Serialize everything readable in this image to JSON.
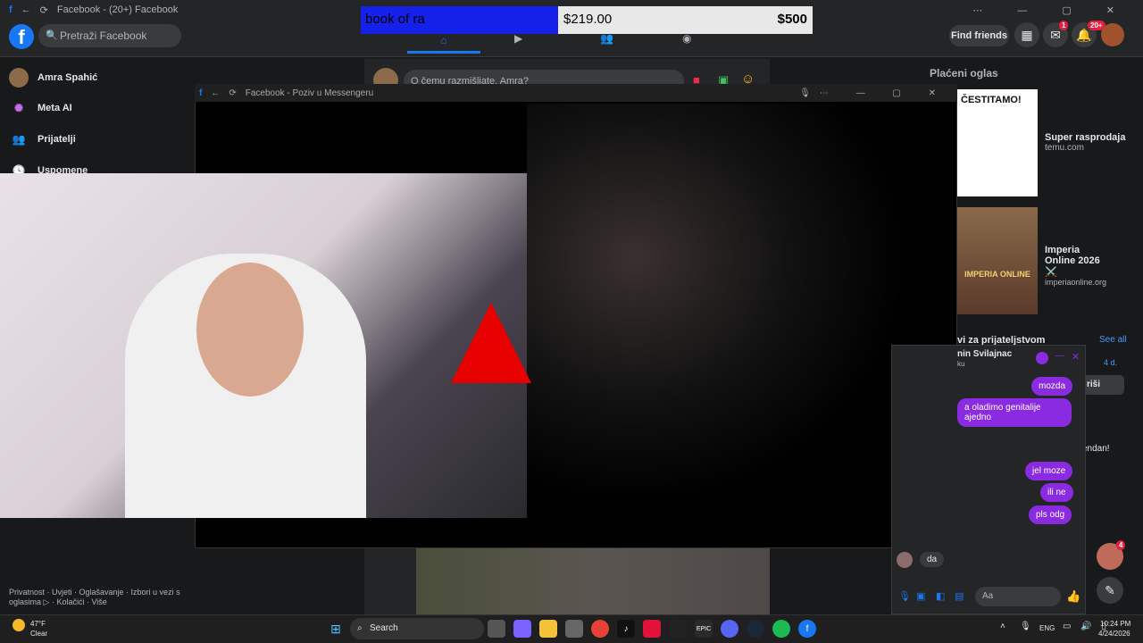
{
  "browser_title": "Facebook - (20+) Facebook",
  "overlay": {
    "game": "book of ra",
    "balance": "$219.00",
    "bet": "$500"
  },
  "search_placeholder": "Pretraži Facebook",
  "top_right": {
    "find_friends": "Find friends",
    "messenger_badge": "1",
    "notifications_badge": "20+"
  },
  "left_nav": [
    {
      "label": "Amra Spahić",
      "icon": "avatar-icon"
    },
    {
      "label": "Meta AI",
      "icon": "meta-ai-icon"
    },
    {
      "label": "Prijatelji",
      "icon": "friends-icon"
    },
    {
      "label": "Uspomene",
      "icon": "memories-icon"
    }
  ],
  "composer_placeholder": "O čemu razmišljate, Amra?",
  "popup": {
    "title": "Facebook - Poziv u Messengeru"
  },
  "sponsored": {
    "heading": "Plaćeni oglas",
    "ads": [
      {
        "title": "Super rasprodaja",
        "domain": "temu.com",
        "img_text": "ČESTITAMO!"
      },
      {
        "title": "Imperia Online 2026 ⚔️",
        "domain": "imperiaonline.org",
        "img_text": "IMPERIA ONLINE"
      }
    ]
  },
  "friend_requests": {
    "heading": "vi za prijateljstvom",
    "see_all": "See all",
    "time": "4 d.",
    "button": "riši",
    "fragment": "endan!"
  },
  "chat": {
    "name": "nin Svilajnac",
    "sub": "ku",
    "messages_out": [
      "mozda",
      "a oladimo genitalije ajedno",
      "jel moze",
      "ili ne",
      "pls odg"
    ],
    "incoming": "da",
    "input_placeholder": "Aa"
  },
  "footer_links": "Privatnost · Uvjeti · Oglašavanje · Izbori u vezi s oglasima ▷ · Kolačići · Više",
  "float_badge": "4",
  "taskbar": {
    "temp": "47°F",
    "weather": "Clear",
    "search": "Search",
    "lang": "ENG",
    "time": "10:24 PM",
    "date": "4/24/2026"
  },
  "colors": {
    "fb_blue": "#1877f2",
    "messenger_purple": "#8a2be2",
    "bg": "#18191a",
    "surface": "#242526"
  }
}
